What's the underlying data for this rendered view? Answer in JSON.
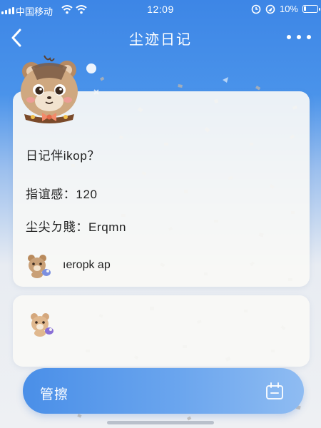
{
  "status_bar": {
    "carrier": "中国移动",
    "time": "12:09",
    "battery": "10%",
    "icons": [
      "signal-icon",
      "wifi-icon",
      "alarm-icon",
      "location-icon",
      "battery-icon"
    ]
  },
  "nav": {
    "title": "尘迹日记",
    "back_icon": "chevron-left-icon",
    "more_icon": "more-dots-icon"
  },
  "card": {
    "rows": [
      {
        "text": "日记伴ikop？"
      },
      {
        "text": "指谊感：120"
      },
      {
        "text": "尘尖ㄉ賤：Erqmn"
      }
    ],
    "companion": {
      "name": "ıeropk ap",
      "icon": "bear-avatar-icon"
    }
  },
  "second_card": {
    "icon": "bear-avatar-icon"
  },
  "action": {
    "label": "管擦",
    "icon": "calendar-box-icon"
  },
  "colors": {
    "primary": "#3d86e6",
    "button": "#5e9eec",
    "text": "#222222",
    "card": "#f8f8f6"
  }
}
